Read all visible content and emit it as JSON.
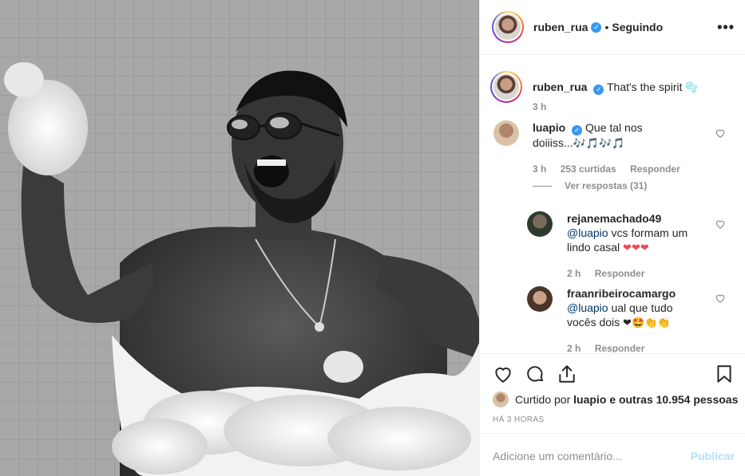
{
  "header": {
    "username": "ruben_rua",
    "verified_mark": "✓",
    "separator": "•",
    "follow_status": "Seguindo",
    "more_label": "•••"
  },
  "comments": {
    "caption": {
      "username": "ruben_rua",
      "text": "That's the spirit",
      "emoji": "🫧",
      "time": "3 h"
    },
    "items": [
      {
        "username": "luapio",
        "text_line1": "Que tal nos",
        "text_line2": "doiiiss...",
        "emoji": "🎶🎵🎶🎵",
        "time": "3 h",
        "likes": "253 curtidas",
        "reply": "Responder",
        "view_replies": "Ver respostas (31)"
      },
      {
        "username": "rejanemachado49",
        "mention": "@luapio",
        "text_line1": " vcs formam um",
        "text_line2": "lindo casal",
        "emoji": "❤❤❤",
        "time": "2 h",
        "reply": "Responder"
      },
      {
        "username": "fraanribeirocamargo",
        "mention": "@luapio",
        "text_line1": " ual que tudo",
        "text_line2": "vocês dois",
        "emoji": "❤🤩👏👏",
        "time": "2 h",
        "reply": "Responder"
      }
    ]
  },
  "actions": {
    "icons": [
      "heart-icon",
      "comment-icon",
      "share-icon",
      "bookmark-icon"
    ],
    "liked_prefix": "Curtido por",
    "liked_user": "luapio",
    "liked_suffix": "e outras 10.954 pessoas",
    "time_ago": "HÁ 3 HORAS"
  },
  "add_comment": {
    "placeholder": "Adicione um comentário...",
    "publish": "Publicar"
  },
  "colors": {
    "link": "#003569",
    "muted": "#8e8e8e",
    "verified": "#3897f0",
    "publish_disabled": "#b2dffc"
  }
}
